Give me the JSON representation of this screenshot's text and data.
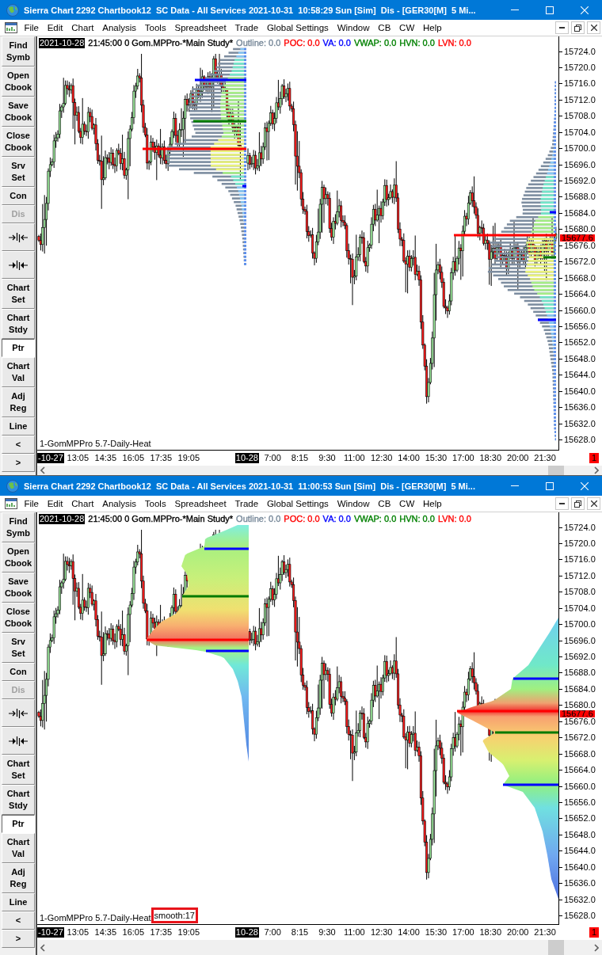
{
  "windows": [
    {
      "title": "Sierra Chart 2292 Chartbook12  SC Data - All Services 2021-10-31  10:58:29 Sun [Sim]  Dis - [GER30[M]  5 Mi...",
      "menu": [
        "File",
        "Edit",
        "Chart",
        "Analysis",
        "Tools",
        "Spreadsheet",
        "Trade",
        "Global Settings",
        "Window",
        "CB",
        "CW",
        "Help"
      ],
      "toolbar": [
        {
          "kind": "text",
          "label": "Find\nSymb",
          "selected": false,
          "disabled": false
        },
        {
          "kind": "text",
          "label": "Open\nCbook",
          "selected": false,
          "disabled": false
        },
        {
          "kind": "text",
          "label": "Save\nCbook",
          "selected": false,
          "disabled": false
        },
        {
          "kind": "text",
          "label": "Close\nCbook",
          "selected": false,
          "disabled": false
        },
        {
          "kind": "text",
          "label": "Srv\nSet",
          "selected": false,
          "disabled": false
        },
        {
          "kind": "text",
          "label": "Con",
          "selected": false,
          "disabled": false
        },
        {
          "kind": "text",
          "label": "Dis",
          "selected": false,
          "disabled": true
        },
        {
          "kind": "narrow",
          "selected": false,
          "disabled": false
        },
        {
          "kind": "widen",
          "selected": false,
          "disabled": false
        },
        {
          "kind": "text",
          "label": "Chart\nSet",
          "selected": false,
          "disabled": false
        },
        {
          "kind": "text",
          "label": "Chart\nStdy",
          "selected": false,
          "disabled": false
        },
        {
          "kind": "text",
          "label": "Ptr",
          "selected": true,
          "disabled": false
        },
        {
          "kind": "text",
          "label": "Chart\nVal",
          "selected": false,
          "disabled": false
        },
        {
          "kind": "text",
          "label": "Adj\nReg",
          "selected": false,
          "disabled": false
        },
        {
          "kind": "text",
          "label": "Line",
          "selected": false,
          "disabled": false
        },
        {
          "kind": "text",
          "label": "<",
          "selected": false,
          "disabled": false
        },
        {
          "kind": "text",
          "label": ">",
          "selected": false,
          "disabled": false
        }
      ],
      "legend": [
        {
          "kind": "date",
          "text": "2021-10-28"
        },
        {
          "kind": "text",
          "text": "21:45:00 0 Gom.MPPro-*Main Study*",
          "color": "#000000"
        },
        {
          "kind": "text",
          "text": "Outline: 0.0",
          "color": "#778899"
        },
        {
          "kind": "text",
          "text": "POC: 0.0",
          "color": "#ff0000"
        },
        {
          "kind": "text",
          "text": "VA: 0.0",
          "color": "#0000ff"
        },
        {
          "kind": "text",
          "text": "VWAP: 0.0",
          "color": "#008000"
        },
        {
          "kind": "text",
          "text": "HVN: 0.0",
          "color": "#008000"
        },
        {
          "kind": "text",
          "text": "LVN: 0.0",
          "color": "#ff0000"
        }
      ],
      "chart": {
        "kind": "bars"
      },
      "study_labels": [
        {
          "text": "1-GomMPPro 5.7-Daily-Heat",
          "boxed": false
        }
      ],
      "price_axis": [
        "15724.0",
        "15720.0",
        "15716.0",
        "15712.0",
        "15708.0",
        "15704.0",
        "15700.0",
        "15696.0",
        "15692.0",
        "15688.0",
        "15684.0",
        "15680.0",
        "15676.0",
        "15672.0",
        "15668.0",
        "15664.0",
        "15660.0",
        "15656.0",
        "15652.0",
        "15648.0",
        "15644.0",
        "15640.0",
        "15636.0",
        "15632.0",
        "15628.0"
      ],
      "last_price": "15677.6",
      "time_axis": [
        {
          "kind": "date",
          "label": "-10-27"
        },
        {
          "kind": "time",
          "label": "13:05"
        },
        {
          "kind": "time",
          "label": "14:35"
        },
        {
          "kind": "time",
          "label": "16:05"
        },
        {
          "kind": "time",
          "label": "17:35"
        },
        {
          "kind": "time",
          "label": "19:05"
        },
        {
          "kind": "date",
          "label": "10-28"
        },
        {
          "kind": "time",
          "label": "7:00"
        },
        {
          "kind": "time",
          "label": "8:15"
        },
        {
          "kind": "time",
          "label": "9:30"
        },
        {
          "kind": "time",
          "label": "11:00"
        },
        {
          "kind": "time",
          "label": "12:30"
        },
        {
          "kind": "time",
          "label": "14:00"
        },
        {
          "kind": "time",
          "label": "15:30"
        },
        {
          "kind": "time",
          "label": "17:00"
        },
        {
          "kind": "time",
          "label": "18:30"
        },
        {
          "kind": "time",
          "label": "20:00"
        },
        {
          "kind": "time",
          "label": "21:30"
        }
      ],
      "alert_badge": "1"
    },
    {
      "title": "Sierra Chart 2292 Chartbook12  SC Data - All Services 2021-10-31  11:00:53 Sun [Sim]  Dis - [GER30[M]  5 Mi...",
      "menu": [
        "File",
        "Edit",
        "Chart",
        "Analysis",
        "Tools",
        "Spreadsheet",
        "Trade",
        "Global Settings",
        "Window",
        "CB",
        "CW",
        "Help"
      ],
      "toolbar": [
        {
          "kind": "text",
          "label": "Find\nSymb",
          "selected": false,
          "disabled": false
        },
        {
          "kind": "text",
          "label": "Open\nCbook",
          "selected": false,
          "disabled": false
        },
        {
          "kind": "text",
          "label": "Save\nCbook",
          "selected": false,
          "disabled": false
        },
        {
          "kind": "text",
          "label": "Close\nCbook",
          "selected": false,
          "disabled": false
        },
        {
          "kind": "text",
          "label": "Srv\nSet",
          "selected": false,
          "disabled": false
        },
        {
          "kind": "text",
          "label": "Con",
          "selected": false,
          "disabled": false
        },
        {
          "kind": "text",
          "label": "Dis",
          "selected": false,
          "disabled": true
        },
        {
          "kind": "narrow",
          "selected": false,
          "disabled": false
        },
        {
          "kind": "widen",
          "selected": false,
          "disabled": false
        },
        {
          "kind": "text",
          "label": "Chart\nSet",
          "selected": false,
          "disabled": false
        },
        {
          "kind": "text",
          "label": "Chart\nStdy",
          "selected": false,
          "disabled": false
        },
        {
          "kind": "text",
          "label": "Ptr",
          "selected": true,
          "disabled": false
        },
        {
          "kind": "text",
          "label": "Chart\nVal",
          "selected": false,
          "disabled": false
        },
        {
          "kind": "text",
          "label": "Adj\nReg",
          "selected": false,
          "disabled": false
        },
        {
          "kind": "text",
          "label": "Line",
          "selected": false,
          "disabled": false
        },
        {
          "kind": "text",
          "label": "<",
          "selected": false,
          "disabled": false
        },
        {
          "kind": "text",
          "label": ">",
          "selected": false,
          "disabled": false
        }
      ],
      "legend": [
        {
          "kind": "date",
          "text": "2021-10-28"
        },
        {
          "kind": "text",
          "text": "21:45:00 0 Gom.MPPro-*Main Study*",
          "color": "#000000"
        },
        {
          "kind": "text",
          "text": "Outline: 0.0",
          "color": "#778899"
        },
        {
          "kind": "text",
          "text": "POC: 0.0",
          "color": "#ff0000"
        },
        {
          "kind": "text",
          "text": "VA: 0.0",
          "color": "#0000ff"
        },
        {
          "kind": "text",
          "text": "VWAP: 0.0",
          "color": "#008000"
        },
        {
          "kind": "text",
          "text": "HVN: 0.0",
          "color": "#008000"
        },
        {
          "kind": "text",
          "text": "LVN: 0.0",
          "color": "#ff0000"
        }
      ],
      "chart": {
        "kind": "gradient"
      },
      "study_labels": [
        {
          "text": "1-GomMPPro 5.7-Daily-Heat",
          "boxed": false
        },
        {
          "text": "smooth:17",
          "boxed": true
        }
      ],
      "price_axis": [
        "15724.0",
        "15720.0",
        "15716.0",
        "15712.0",
        "15708.0",
        "15704.0",
        "15700.0",
        "15696.0",
        "15692.0",
        "15688.0",
        "15684.0",
        "15680.0",
        "15676.0",
        "15672.0",
        "15668.0",
        "15664.0",
        "15660.0",
        "15656.0",
        "15652.0",
        "15648.0",
        "15644.0",
        "15640.0",
        "15636.0",
        "15632.0",
        "15628.0"
      ],
      "last_price": "15677.6",
      "time_axis": [
        {
          "kind": "date",
          "label": "-10-27"
        },
        {
          "kind": "time",
          "label": "13:05"
        },
        {
          "kind": "time",
          "label": "14:35"
        },
        {
          "kind": "time",
          "label": "16:05"
        },
        {
          "kind": "time",
          "label": "17:35"
        },
        {
          "kind": "time",
          "label": "19:05"
        },
        {
          "kind": "date",
          "label": "10-28"
        },
        {
          "kind": "time",
          "label": "7:00"
        },
        {
          "kind": "time",
          "label": "8:15"
        },
        {
          "kind": "time",
          "label": "9:30"
        },
        {
          "kind": "time",
          "label": "11:00"
        },
        {
          "kind": "time",
          "label": "12:30"
        },
        {
          "kind": "time",
          "label": "14:00"
        },
        {
          "kind": "time",
          "label": "15:30"
        },
        {
          "kind": "time",
          "label": "17:00"
        },
        {
          "kind": "time",
          "label": "18:30"
        },
        {
          "kind": "time",
          "label": "20:00"
        },
        {
          "kind": "time",
          "label": "21:30"
        }
      ],
      "alert_badge": "1"
    }
  ]
}
